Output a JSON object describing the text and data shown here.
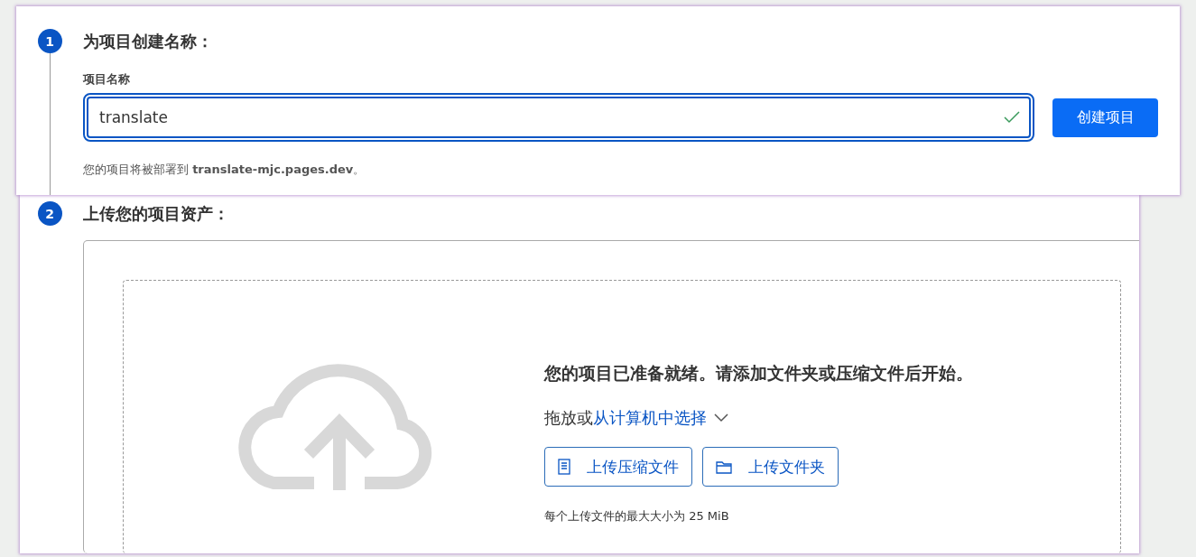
{
  "step_1": {
    "number": "1",
    "title": "为项目创建名称：",
    "field": {
      "label": "项目名称",
      "value": "translate",
      "valid": true
    },
    "button": "创建项目",
    "hint": "您的项目将被部署到 **translate-mjc.pages.dev**。"
  },
  "step_2": {
    "number": "2",
    "title": "上传您的项目资产：",
    "upload": {
      "heading": "您的项目已准备就绪。请添加文件夹或压缩文件后开始。",
      "prompt": "拖放或",
      "link": "从计算机中选择",
      "buttons": [
        {
          "kind": "zip",
          "label": "上传压缩文件"
        },
        {
          "kind": "folder",
          "label": "上传文件夹"
        }
      ],
      "note": "每个上传文件的最大大小为 25 MiB"
    }
  }
}
